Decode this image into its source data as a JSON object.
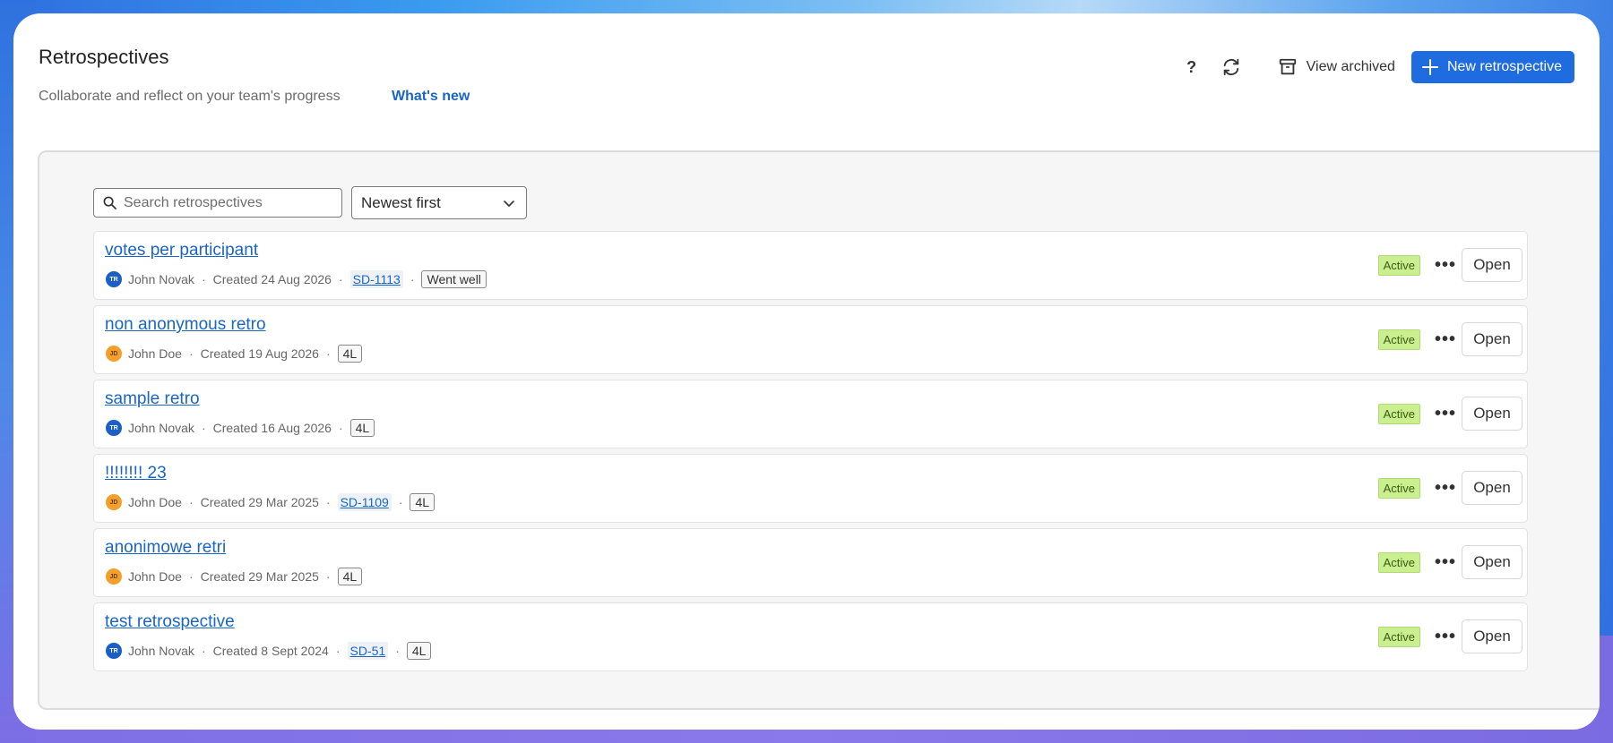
{
  "header": {
    "title": "Retrospectives",
    "subtitle": "Collaborate and reflect on your team's progress",
    "whats_new": "What's new"
  },
  "toolbar": {
    "help_icon": "help-icon",
    "help_label": "?",
    "refresh_icon": "refresh-icon",
    "view_archived": "View archived",
    "new_retro": "New retrospective"
  },
  "filters": {
    "search_placeholder": "Search retrospectives",
    "sort_value": "Newest first"
  },
  "colors": {
    "accent": "#1e6ce0",
    "link": "#1a66c4",
    "status_active": "#c9ef8f"
  },
  "retros": [
    {
      "title": "votes per participant",
      "avatar_initials": "TR",
      "avatar_color": "blue",
      "author": "John Novak",
      "created": "Created 24 Aug 2026",
      "key": "SD-1113",
      "tag": "Went well",
      "status": "Active",
      "open": "Open"
    },
    {
      "title": "non anonymous retro",
      "avatar_initials": "JD",
      "avatar_color": "orange",
      "author": "John Doe",
      "created": "Created 19 Aug 2026",
      "key": "",
      "tag": "4L",
      "status": "Active",
      "open": "Open"
    },
    {
      "title": "sample retro",
      "avatar_initials": "TR",
      "avatar_color": "blue",
      "author": "John Novak",
      "created": "Created 16 Aug 2026",
      "key": "",
      "tag": "4L",
      "status": "Active",
      "open": "Open"
    },
    {
      "title": "!!!!!!!! 23",
      "avatar_initials": "JD",
      "avatar_color": "orange",
      "author": "John Doe",
      "created": "Created 29 Mar 2025",
      "key": "SD-1109",
      "tag": "4L",
      "status": "Active",
      "open": "Open"
    },
    {
      "title": "anonimowe retri",
      "avatar_initials": "JD",
      "avatar_color": "orange",
      "author": "John Doe",
      "created": "Created 29 Mar 2025",
      "key": "",
      "tag": "4L",
      "status": "Active",
      "open": "Open"
    },
    {
      "title": "test retrospective",
      "avatar_initials": "TR",
      "avatar_color": "blue",
      "author": "John Novak",
      "created": "Created 8 Sept 2024",
      "key": "SD-51",
      "tag": "4L",
      "status": "Active",
      "open": "Open"
    }
  ]
}
